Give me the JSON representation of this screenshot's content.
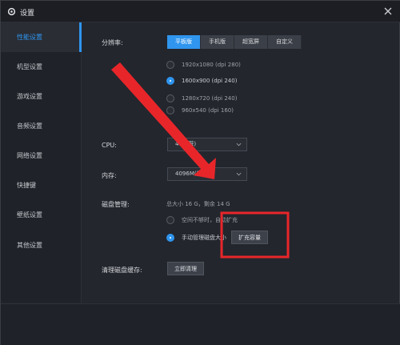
{
  "window": {
    "title": "设置"
  },
  "sidebar": {
    "items": [
      {
        "label": "性能设置",
        "active": true
      },
      {
        "label": "机型设置"
      },
      {
        "label": "游戏设置"
      },
      {
        "label": "音频设置"
      },
      {
        "label": "网络设置"
      },
      {
        "label": "快捷键"
      },
      {
        "label": "壁纸设置"
      },
      {
        "label": "其他设置"
      }
    ]
  },
  "performance": {
    "resolution_label": "分辨率:",
    "resolution_tabs": [
      "平板版",
      "手机版",
      "超宽屏",
      "自定义"
    ],
    "resolution_options": [
      {
        "label": "1920x1080  (dpi 280)",
        "selected": false
      },
      {
        "label": "1600x900  (dpi 240)",
        "selected": true
      },
      {
        "label": "1280x720  (dpi 240)",
        "selected": false
      },
      {
        "label": "960x540  (dpi 160)",
        "selected": false
      }
    ],
    "cpu_label": "CPU:",
    "cpu_value": "4 (推荐)",
    "memory_label": "内存:",
    "memory_value": "4096M(推荐)",
    "disk_label": "磁盘管理:",
    "disk_info": "总大小 16 G，剩余 14 G",
    "disk_options": [
      {
        "label": "空间不够时，自动扩充",
        "selected": false
      },
      {
        "label": "手动管理磁盘大小",
        "selected": true
      }
    ],
    "expand_button": "扩充容量",
    "clear_cache_label": "清理磁盘缓存:",
    "clear_button": "立即清理"
  },
  "colors": {
    "accent": "#2f95ee",
    "annotation": "#e8262a",
    "background": "#23262d"
  },
  "icons": {
    "title": "gear-icon",
    "close": "close-icon",
    "dropdown": "chevron-down-icon"
  }
}
